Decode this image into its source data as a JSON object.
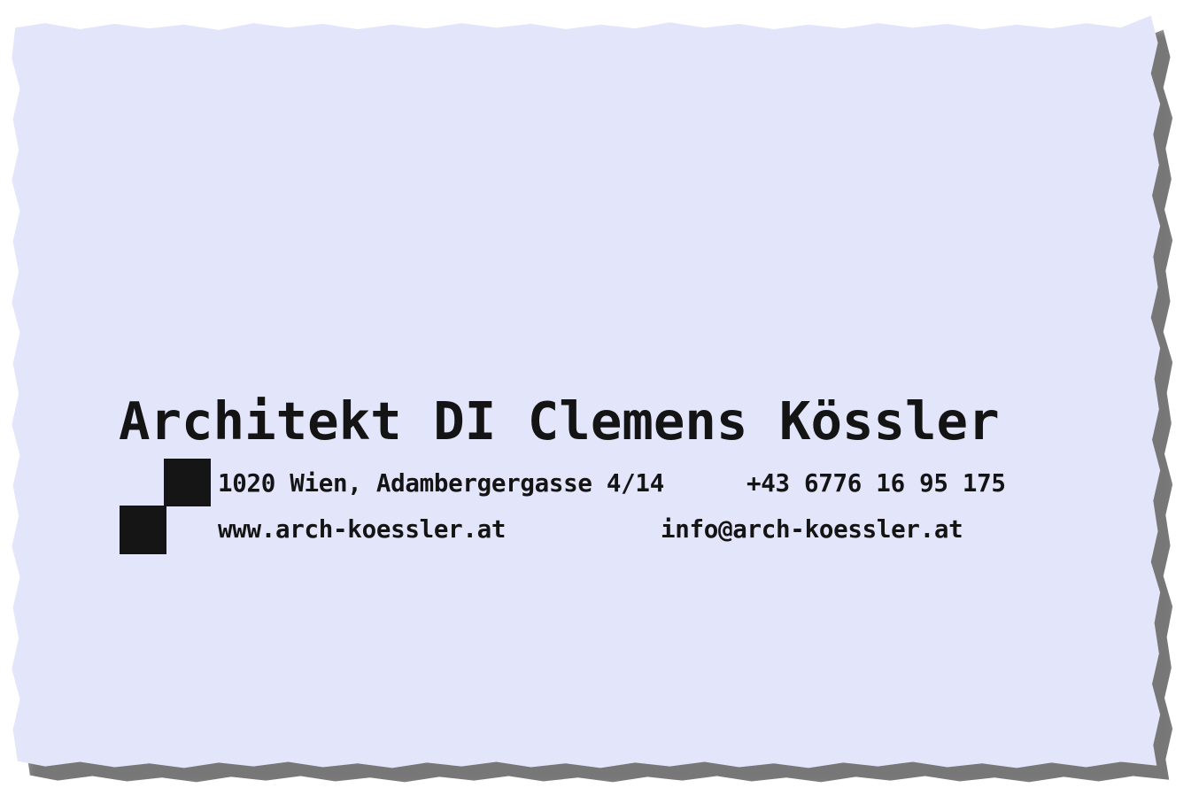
{
  "card": {
    "name": "Architekt DI Clemens Kössler",
    "address": "1020 Wien, Adambergergasse 4/14",
    "phone": "+43 6776 16 95 175",
    "website": "www.arch-koessler.at",
    "email": "info@arch-koessler.at"
  },
  "colors": {
    "paper": "#e3e6fb",
    "ink": "#141414"
  },
  "icons": {
    "logo": "checkerboard-squares-logo"
  }
}
